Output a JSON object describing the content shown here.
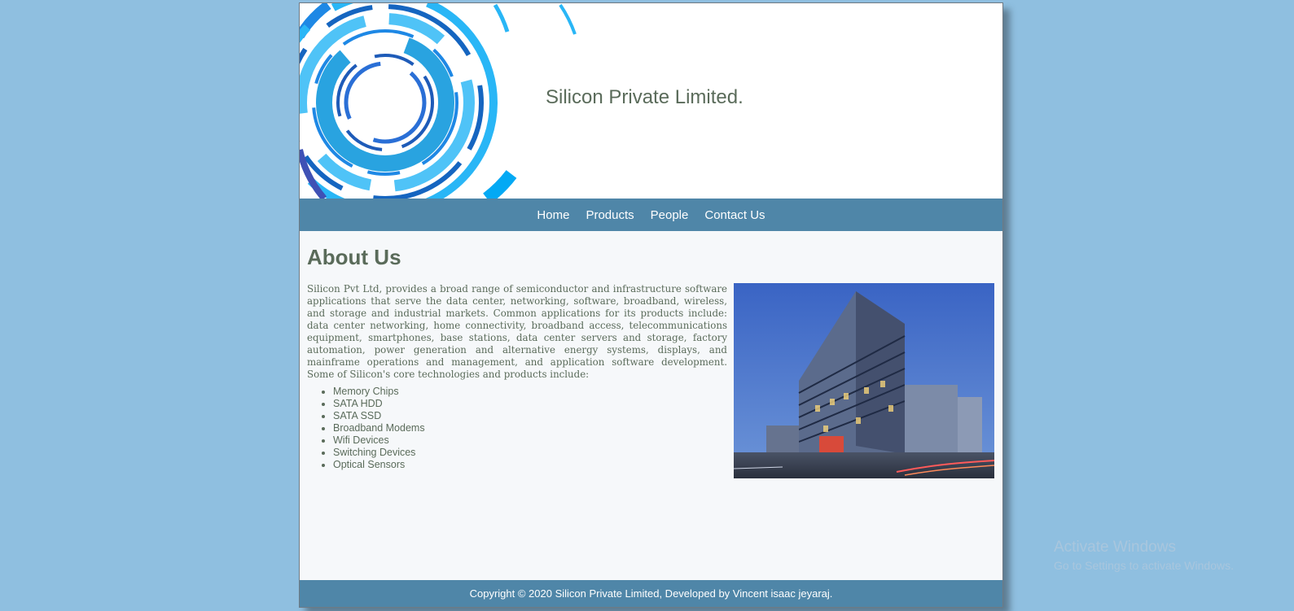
{
  "header": {
    "company_name": "Silicon Private Limited."
  },
  "nav": {
    "items": [
      {
        "label": "Home"
      },
      {
        "label": "Products"
      },
      {
        "label": "People"
      },
      {
        "label": "Contact Us"
      }
    ]
  },
  "main": {
    "heading": "About Us",
    "description": "Silicon Pvt Ltd, provides a broad range of semiconductor and infrastructure software applications that serve the data center, networking, software, broadband, wireless, and storage and industrial markets. Common applications for its products include: data center networking, home connectivity, broadband access, telecommunications equipment, smartphones, base stations, data center servers and storage, factory automation, power generation and alternative energy systems, displays, and mainframe operations and management, and application software development. Some of Silicon's core technologies and products include:",
    "products": [
      "Memory Chips",
      "SATA HDD",
      "SATA SSD",
      "Broadband Modems",
      "Wifi Devices",
      "Switching Devices",
      "Optical Sensors"
    ]
  },
  "footer": {
    "text": "Copyright © 2020 Silicon Private Limited, Developed by Vincent isaac jeyaraj."
  },
  "os_overlay": {
    "title": "Activate Windows",
    "subtitle": "Go to Settings to activate Windows."
  },
  "colors": {
    "background": "#8fbfe0",
    "nav_bar": "#4f86a8",
    "text": "#5a6b5a"
  }
}
